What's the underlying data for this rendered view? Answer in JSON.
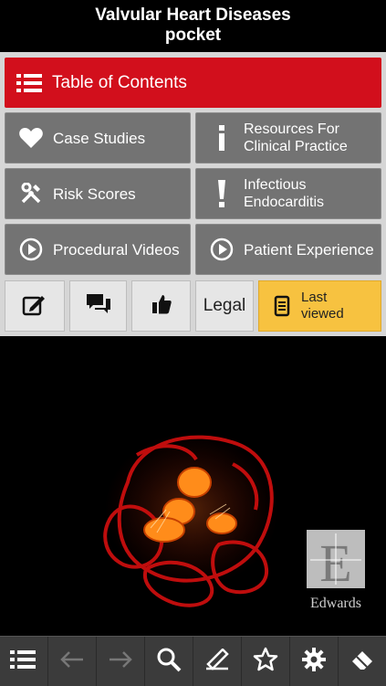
{
  "header": {
    "title_line1": "Valvular Heart Diseases",
    "title_line2": "pocket"
  },
  "menu": {
    "toc": {
      "label": "Table of Contents",
      "icon": "list-icon"
    },
    "case_studies": {
      "label": "Case Studies",
      "icon": "heart-icon"
    },
    "resources": {
      "label_line1": "Resources For",
      "label_line2": "Clinical Practice",
      "icon": "info-icon"
    },
    "risk_scores": {
      "label": "Risk Scores",
      "icon": "tools-icon"
    },
    "endocarditis": {
      "label_line1": "Infectious",
      "label_line2": "Endocarditis",
      "icon": "exclamation-icon"
    },
    "videos": {
      "label": "Procedural Videos",
      "icon": "play-icon"
    },
    "patient": {
      "label": "Patient Experience",
      "icon": "play-icon"
    },
    "small": {
      "feedback_icon": "edit-note-icon",
      "chat_icon": "chat-icon",
      "like_icon": "thumbs-up-icon",
      "legal_label": "Legal",
      "last_viewed_line1": "Last",
      "last_viewed_line2": "viewed",
      "last_viewed_icon": "document-icon"
    }
  },
  "media": {
    "logo_text": "Edwards"
  },
  "toolbar": {
    "items": [
      "list-icon",
      "back-arrow-icon",
      "forward-arrow-icon",
      "search-icon",
      "pen-icon",
      "star-icon",
      "gear-icon",
      "eraser-icon"
    ]
  },
  "colors": {
    "red": "#d20f1c",
    "gray": "#737373",
    "yellow": "#f7c240",
    "toolbar": "#3b3b3b"
  }
}
